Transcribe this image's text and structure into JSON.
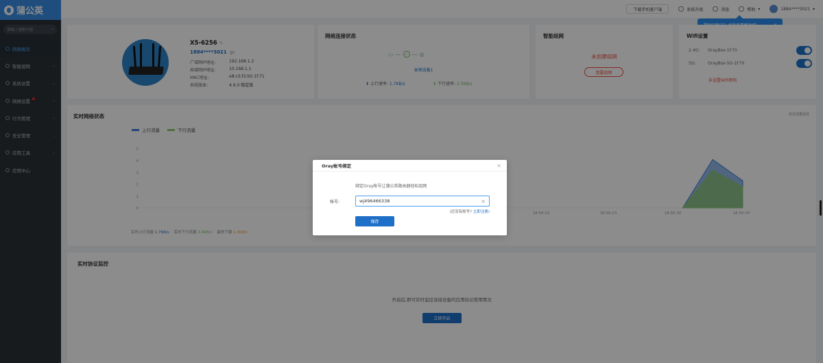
{
  "app": {
    "logo": "蒲公英"
  },
  "sidebar": {
    "search_placeholder": "请输入搜索内容",
    "items": [
      {
        "label": "网络概览"
      },
      {
        "label": "智能组网"
      },
      {
        "label": "系统设置"
      },
      {
        "label": "网络设置"
      },
      {
        "label": "行为管理"
      },
      {
        "label": "安全管理"
      },
      {
        "label": "应用工具"
      },
      {
        "label": "应用中心"
      }
    ]
  },
  "topbar": {
    "download_app": "下载手机客户端",
    "upgrade": "系统升级",
    "messages": "消息",
    "help": "帮助",
    "user": "1884****3021"
  },
  "tooltip": {
    "text": "遇到问题了？点我查看帮助吧~",
    "close": "×"
  },
  "device": {
    "name": "X5-6256",
    "account": "1884****3021",
    "tag": "gz",
    "fields": [
      {
        "key": "广域网IP地址:",
        "value": "192.168.1.2"
      },
      {
        "key": "局域网IP地址:",
        "value": "10.168.1.1"
      },
      {
        "key": "MAC地址:",
        "value": "e8:c5:f2:b5:1f:71"
      },
      {
        "key": "系统版本:",
        "value": "4.9.0 稳定版"
      }
    ]
  },
  "connection": {
    "title": "网络连接状态",
    "status": "本地设备1",
    "up_label": "上行速率:",
    "up_value": "1.7KB/s",
    "down_label": "下行速率:",
    "down_value": "2.0KB/s"
  },
  "smart_net": {
    "title": "智能组网",
    "status": "未创建组网",
    "button": "我要组网"
  },
  "wifi": {
    "title": "Wifi设置",
    "bands": [
      {
        "band": "2.4G:",
        "ssid": "OrayBox-1F70",
        "on": true
      },
      {
        "band": "5G:",
        "ssid": "OrayBox-5G-1F70",
        "on": true
      }
    ],
    "warning": "未设置Wifi密码"
  },
  "realtime": {
    "title": "实时网络状态",
    "link": "前往流量监控",
    "footer": {
      "up_label": "实时上行流量",
      "up_value": "1.7KB/s",
      "down_label": "实时下行流量",
      "down_value": "2.4KB/s",
      "delay_label": "最快下载",
      "delay_value": "1.3KB/s"
    }
  },
  "chart_data": {
    "type": "area",
    "series": [
      {
        "name": "上行流量",
        "color": "#3a7fd8",
        "values": [
          0,
          0,
          0,
          0,
          0,
          0,
          0,
          0,
          0,
          0,
          0,
          0,
          0,
          0,
          0,
          0,
          0,
          0,
          0,
          4.1,
          2.3
        ]
      },
      {
        "name": "下行流量",
        "color": "#8cc66d",
        "values": [
          0,
          0,
          0,
          0,
          0,
          0,
          0,
          0,
          0,
          0,
          0,
          0,
          0,
          0,
          0,
          0,
          0,
          0,
          0,
          3.2,
          1.8
        ]
      }
    ],
    "yticks": [
      "0",
      "1",
      "2",
      "3",
      "4",
      "5"
    ],
    "xticks": [
      "18:56:22",
      "18:56:23",
      "18:56:26",
      "18:56:34"
    ],
    "ylim": [
      0,
      5
    ]
  },
  "monitor": {
    "title": "实时协议监控",
    "text": "开启后,即可实时监控连接设备的应用协议使用情况",
    "button": "立即开启"
  },
  "modal": {
    "title": "Oray帐号绑定",
    "close": "×",
    "tip": "绑定Oray帐号让蒲公英路由器轻松组网",
    "label": "帐号:",
    "value": "wj496466338",
    "link_prefix": "(还没有帐号? ",
    "link": "立即注册)",
    "save": "保存"
  }
}
